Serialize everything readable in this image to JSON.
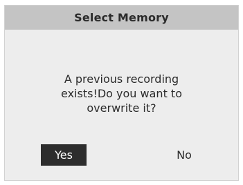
{
  "dialog": {
    "title": "Select Memory",
    "message": "A previous recording\nexists!Do you want to\noverwrite it?",
    "buttons": {
      "yes_label": "Yes",
      "no_label": "No"
    },
    "selected_button": "Yes"
  },
  "colors": {
    "title_bar": "#c4c4c4",
    "dialog_bg": "#ededed",
    "selected_button_bg": "#2d2d2d",
    "text": "#2b2b2b"
  }
}
